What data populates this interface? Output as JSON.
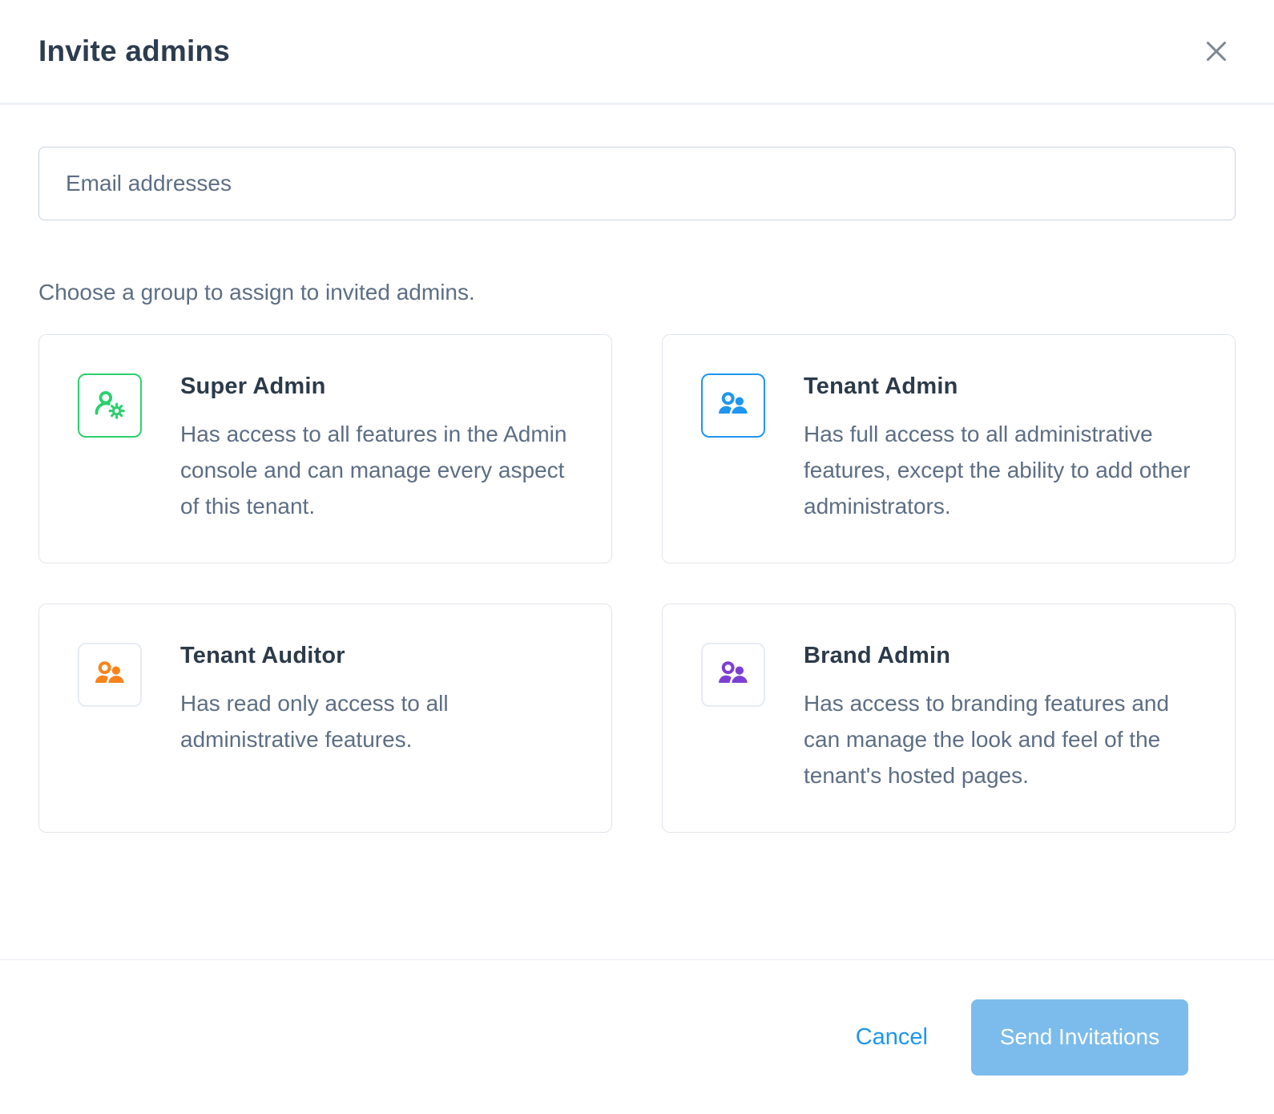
{
  "modal": {
    "title": "Invite admins",
    "close_icon": "x-close-icon"
  },
  "form": {
    "email_placeholder": "Email addresses",
    "choose_label": "Choose a group to assign to invited admins."
  },
  "groups": [
    {
      "name": "Super Admin",
      "description": "Has access to all features in the Admin console and can manage every aspect of this tenant.",
      "icon": "user-gear-icon",
      "accent": "#2bd06e",
      "box_style": "accent"
    },
    {
      "name": "Tenant Admin",
      "description": "Has full access to all administrative features, except the ability to add other administrators.",
      "icon": "users-icon",
      "accent": "#1e96ef",
      "box_style": "accent"
    },
    {
      "name": "Tenant Auditor",
      "description": "Has read only access to all administrative features.",
      "icon": "users-icon",
      "accent": "#f8831d",
      "box_style": "muted"
    },
    {
      "name": "Brand Admin",
      "description": "Has access to branding features and can manage the look and feel of the tenant's hosted pages.",
      "icon": "users-icon",
      "accent": "#7d3fd3",
      "box_style": "muted"
    }
  ],
  "footer": {
    "cancel_label": "Cancel",
    "submit_label": "Send Invitations",
    "cancel_color": "#1e96ef",
    "submit_bg": "#7cbcec"
  },
  "colors": {
    "title_text": "#2d3c4e",
    "body_text": "#5d6e84",
    "card_border": "#e1e5eb",
    "header_divider": "#eef1f6"
  }
}
